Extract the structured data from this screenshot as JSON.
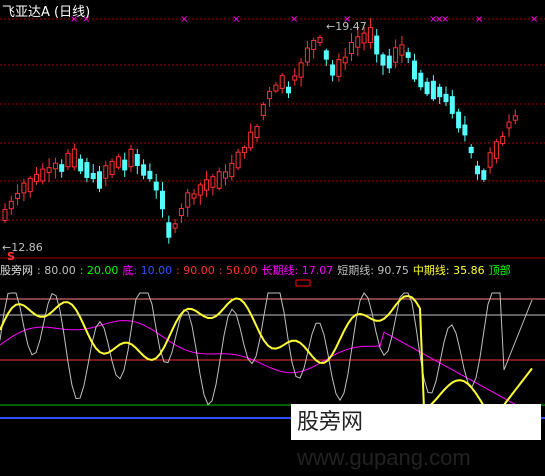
{
  "title": "飞亚达A (日线)",
  "price_chart": {
    "high_label": "19.47",
    "low_label": "12.86",
    "sell_marker": "S",
    "colors": {
      "up": "#ff3232",
      "down": "#54ffff",
      "guide": "#ff0000",
      "marker": "#ff00ff"
    }
  },
  "indicator": {
    "name": "股旁网",
    "levels": [
      {
        "text": ": 80.00",
        "color": "#c0c0c0"
      },
      {
        "text": ": 20.00",
        "color": "#00ff00"
      },
      {
        "text": "底",
        "color": "#ff00ff"
      },
      {
        "text": ": 10.00",
        "color": "#3050ff"
      },
      {
        "text": ": 90.00",
        "color": "#ff3232"
      },
      {
        "text": ": 50.00",
        "color": "#ff3232"
      }
    ],
    "long_label": "长期线: 17.07",
    "short_label": "短期线: 90.75",
    "mid_label": "中期线: 35.86",
    "top_label": "顶部",
    "colors": {
      "long": "#ff00ff",
      "short": "#c0c0c0",
      "mid": "#ffff33",
      "top": "#00ff00"
    }
  },
  "watermark": {
    "text": "股旁网 www.gupang.com"
  }
}
